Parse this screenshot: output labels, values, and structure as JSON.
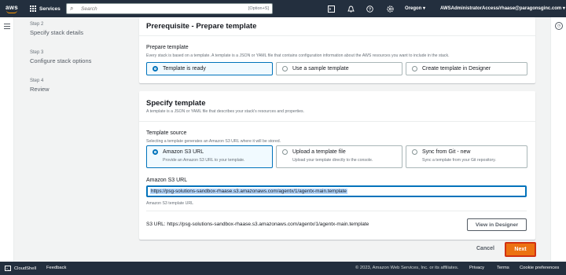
{
  "topnav": {
    "logo_text": "aws",
    "services_label": "Services",
    "search_placeholder": "Search",
    "search_shortcut": "[Option+S]",
    "region": "Oregon ▾",
    "account": "AWSAdministratorAccess/rhaase@paragonsginc.com ▾"
  },
  "steps": [
    {
      "num": "Step 2",
      "name": "Specify stack details"
    },
    {
      "num": "Step 3",
      "name": "Configure stack options"
    },
    {
      "num": "Step 4",
      "name": "Review"
    }
  ],
  "prerequisite": {
    "title": "Prerequisite - Prepare template",
    "label": "Prepare template",
    "description": "Every stack is based on a template. A template is a JSON or YAML file that contains configuration information about the AWS resources you want to include in the stack.",
    "options": [
      {
        "label": "Template is ready",
        "selected": true
      },
      {
        "label": "Use a sample template",
        "selected": false
      },
      {
        "label": "Create template in Designer",
        "selected": false
      }
    ]
  },
  "specify": {
    "title": "Specify template",
    "description": "A template is a JSON or YAML file that describes your stack's resources and properties.",
    "source_label": "Template source",
    "source_description": "Selecting a template generates an Amazon S3 URL where it will be stored.",
    "options": [
      {
        "label": "Amazon S3 URL",
        "desc": "Provide an Amazon S3 URL to your template.",
        "selected": true
      },
      {
        "label": "Upload a template file",
        "desc": "Upload your template directly to the console.",
        "selected": false
      },
      {
        "label": "Sync from Git - new",
        "desc": "Sync a template from your Git repository.",
        "selected": false
      }
    ],
    "url_label": "Amazon S3 URL",
    "url_value": "https://psg-solutions-sandbox-rhaase.s3.amazonaws.com/agentx/1/agentx-main.template",
    "url_hint": "Amazon S3 template URL",
    "s3_url_line": "S3 URL:  https://psg-solutions-sandbox-rhaase.s3.amazonaws.com/agentx/1/agentx-main.template",
    "view_designer": "View in Designer"
  },
  "actions": {
    "cancel": "Cancel",
    "next": "Next"
  },
  "footer": {
    "cloudshell": "CloudShell",
    "feedback": "Feedback",
    "copyright": "© 2023, Amazon Web Services, Inc. or its affiliates.",
    "privacy": "Privacy",
    "terms": "Terms",
    "cookie": "Cookie preferences"
  },
  "colors": {
    "nav": "#232f3e",
    "accent": "#ec7211",
    "link_blue": "#0073bb"
  }
}
